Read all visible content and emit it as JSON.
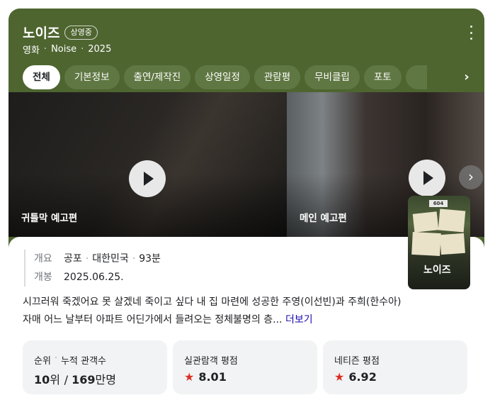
{
  "header": {
    "title": "노이즈",
    "badge": "상영중",
    "meta": [
      "영화",
      "Noise",
      "2025"
    ]
  },
  "tabs": [
    "전체",
    "기본정보",
    "출연/제작진",
    "상영일정",
    "관람평",
    "무비클립",
    "포토"
  ],
  "videos": [
    {
      "label": "귀틀막 예고편"
    },
    {
      "label": "메인 예고편"
    }
  ],
  "info": {
    "overview_key": "개요",
    "genre": "공포",
    "country": "대한민국",
    "runtime": "93분",
    "release_key": "개봉",
    "release_date": "2025.06.25."
  },
  "synopsis": {
    "text": "시끄러워 죽겠어요 못 살겠네 죽이고 싶다 내 집 마련에 성공한 주영(이선빈)과 주희(한수아) 자매 어느 날부터 아파트 어딘가에서 들려오는 정체불명의 층...",
    "more_label": "더보기"
  },
  "poster": {
    "title": "노이즈",
    "number": "604"
  },
  "stats": {
    "rank_label": "순위",
    "audience_label": "누적 관객수",
    "rank": "10",
    "rank_unit": "위",
    "audience": "169",
    "audience_unit": "만명",
    "real_label": "실관람객 평점",
    "real_score": "8.01",
    "netizen_label": "네티즌 평점",
    "netizen_score": "6.92"
  },
  "colors": {
    "hero_bg": "#4e6530",
    "tab_bg": "#5f7742",
    "star": "#d93025",
    "link": "#1a0dab"
  }
}
